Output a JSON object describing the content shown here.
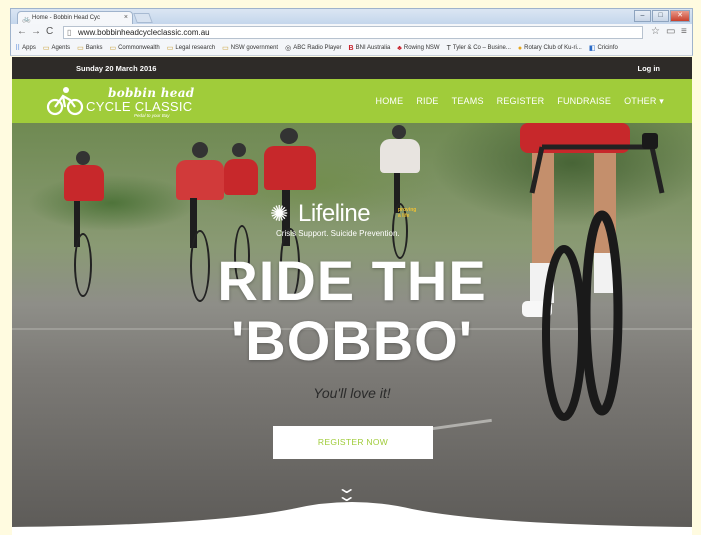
{
  "browser": {
    "tab_title": "Home - Bobbin Head Cyc",
    "tab_close": "×",
    "url": "www.bobbinheadcycleclassic.com.au"
  },
  "bookmarks": [
    {
      "label": "Apps",
      "icon": "apps-grid-icon"
    },
    {
      "label": "Agents",
      "icon": "folder-icon"
    },
    {
      "label": "Banks",
      "icon": "folder-icon"
    },
    {
      "label": "Commonwealth",
      "icon": "folder-icon"
    },
    {
      "label": "Legal research",
      "icon": "folder-icon"
    },
    {
      "label": "NSW government",
      "icon": "folder-icon"
    },
    {
      "label": "ABC Radio Player",
      "icon": "abc-icon"
    },
    {
      "label": "BNI Australia",
      "icon": "bni-icon"
    },
    {
      "label": "Rowing NSW",
      "icon": "rowing-icon"
    },
    {
      "label": "Tyler & Co – Busine...",
      "icon": "tyler-icon"
    },
    {
      "label": "Rotary Club of Ku-ri...",
      "icon": "rotary-icon"
    },
    {
      "label": "Cricinfo",
      "icon": "cricinfo-icon"
    }
  ],
  "topbar": {
    "date": "Sunday 20 March 2016",
    "login": "Log in"
  },
  "logo": {
    "line1": "bobbin head",
    "line2": "CYCLE CLASSIC",
    "tagline": "Pedal to your Bay"
  },
  "nav": [
    {
      "label": "HOME"
    },
    {
      "label": "RIDE"
    },
    {
      "label": "TEAMS"
    },
    {
      "label": "REGISTER"
    },
    {
      "label": "FUNDRAISE"
    },
    {
      "label": "OTHER ▾"
    }
  ],
  "hero": {
    "sponsor_name": "Lifeline",
    "sponsor_tag": "Crisis Support. Suicide Prevention.",
    "sponsor_tiny": "proving a life",
    "headline_1": "RIDE THE",
    "headline_2": "'BOBBO'",
    "subline": "You'll love it!",
    "cta": "REGISTER NOW"
  },
  "colors": {
    "accent_green": "#a0cc3a",
    "topbar_dark": "#2e2b28",
    "jersey_red": "#c7282b"
  }
}
